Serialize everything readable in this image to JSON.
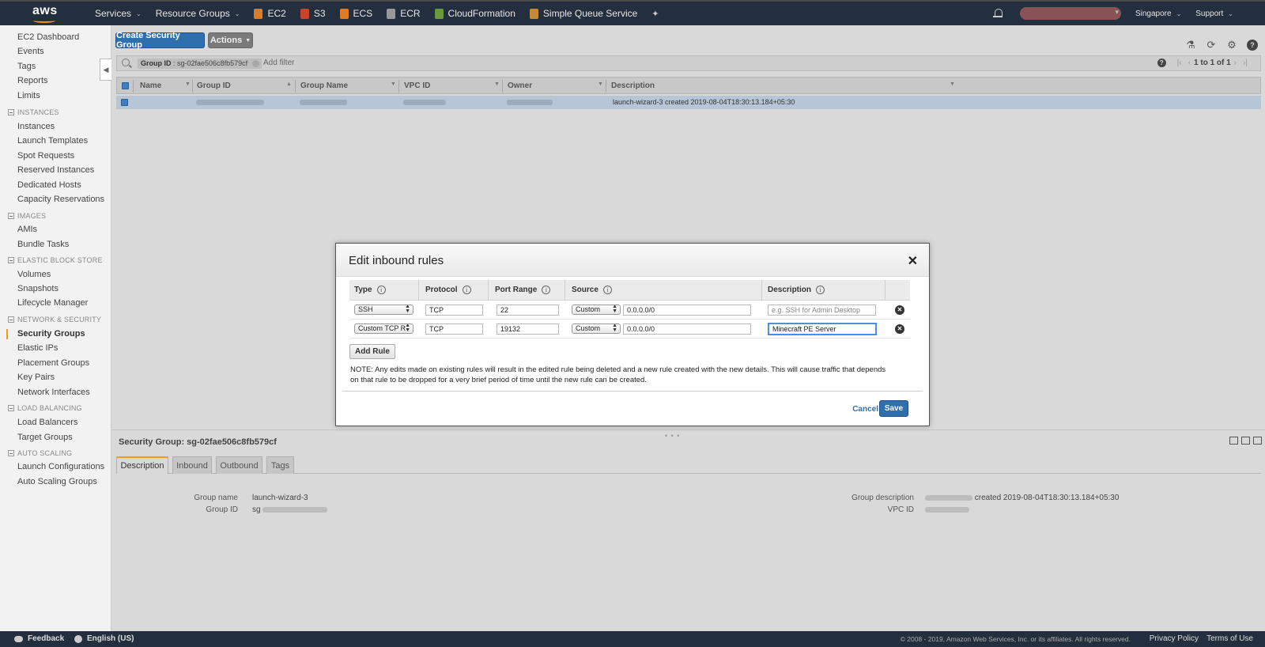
{
  "topnav": {
    "logo": "aws",
    "services": "Services",
    "resource_groups": "Resource Groups",
    "shortcuts": [
      {
        "label": "EC2",
        "icon": "ec2-icon",
        "color": "#e07b24"
      },
      {
        "label": "S3",
        "icon": "s3-icon",
        "color": "#c7432b"
      },
      {
        "label": "ECS",
        "icon": "ecs-icon",
        "color": "#e07b24"
      },
      {
        "label": "ECR",
        "icon": "ecr-icon",
        "color": "#999999"
      },
      {
        "label": "CloudFormation",
        "icon": "cloudformation-icon",
        "color": "#6a9a3b"
      },
      {
        "label": "Simple Queue Service",
        "icon": "sqs-icon",
        "color": "#c68a36"
      }
    ],
    "region": "Singapore",
    "support": "Support"
  },
  "sidebar": {
    "items": {
      "ec2_dashboard": "EC2 Dashboard",
      "events": "Events",
      "tags": "Tags",
      "reports": "Reports",
      "limits": "Limits",
      "instances_section": "INSTANCES",
      "instances": "Instances",
      "launch_templates": "Launch Templates",
      "spot_requests": "Spot Requests",
      "reserved_instances": "Reserved Instances",
      "dedicated_hosts": "Dedicated Hosts",
      "capacity_reservations": "Capacity Reservations",
      "images_section": "IMAGES",
      "amis": "AMIs",
      "bundle_tasks": "Bundle Tasks",
      "ebs_section": "ELASTIC BLOCK STORE",
      "volumes": "Volumes",
      "snapshots": "Snapshots",
      "lifecycle_manager": "Lifecycle Manager",
      "network_section": "NETWORK & SECURITY",
      "security_groups": "Security Groups",
      "elastic_ips": "Elastic IPs",
      "placement_groups": "Placement Groups",
      "key_pairs": "Key Pairs",
      "network_interfaces": "Network Interfaces",
      "lb_section": "LOAD BALANCING",
      "load_balancers": "Load Balancers",
      "target_groups": "Target Groups",
      "as_section": "AUTO SCALING",
      "launch_configurations": "Launch Configurations",
      "auto_scaling_groups": "Auto Scaling Groups"
    }
  },
  "toolbar": {
    "create_label": "Create Security Group",
    "actions_label": "Actions"
  },
  "filter": {
    "chip_key": "Group ID",
    "chip_value": ": sg-02fae506c8fb579cf",
    "add_filter": "Add filter",
    "pagination": "1 to 1 of 1"
  },
  "table": {
    "headers": [
      "Name",
      "Group ID",
      "Group Name",
      "VPC ID",
      "Owner",
      "Description"
    ],
    "row_description": "launch-wizard-3 created 2019-08-04T18:30:13.184+05:30"
  },
  "details": {
    "title": "Security Group: sg-02fae506c8fb579cf",
    "tabs": [
      "Description",
      "Inbound",
      "Outbound",
      "Tags"
    ],
    "group_name_label": "Group name",
    "group_name_value": "launch-wizard-3",
    "group_id_label": "Group ID",
    "group_id_value": "sg",
    "group_description_label": "Group description",
    "group_description_value": "created 2019-08-04T18:30:13.184+05:30",
    "vpc_id_label": "VPC ID"
  },
  "modal": {
    "title": "Edit inbound rules",
    "close": "✕",
    "headers": {
      "type": "Type",
      "protocol": "Protocol",
      "port_range": "Port Range",
      "source": "Source",
      "description": "Description"
    },
    "rules": [
      {
        "type": "SSH",
        "protocol": "TCP",
        "port": "22",
        "source_type": "Custom",
        "cidr": "0.0.0.0/0",
        "description": "",
        "description_placeholder": "e.g. SSH for Admin Desktop"
      },
      {
        "type": "Custom TCP R",
        "protocol": "TCP",
        "port": "19132",
        "source_type": "Custom",
        "cidr": "0.0.0.0/0",
        "description": "Minecraft PE Server",
        "description_placeholder": ""
      }
    ],
    "add_rule": "Add Rule",
    "note": "NOTE: Any edits made on existing rules will result in the edited rule being deleted and a new rule created with the new details. This will cause traffic that depends on that rule to be dropped for a very brief period of time until the new rule can be created.",
    "cancel": "Cancel",
    "save": "Save"
  },
  "footer": {
    "feedback": "Feedback",
    "language": "English (US)",
    "copyright": "© 2008 - 2019, Amazon Web Services, Inc. or its affiliates. All rights reserved.",
    "privacy": "Privacy Policy",
    "terms": "Terms of Use"
  },
  "colors": {
    "nav_bg": "#232f3e",
    "primary_blue": "#2f6fad",
    "active_orange": "#f7981d"
  }
}
